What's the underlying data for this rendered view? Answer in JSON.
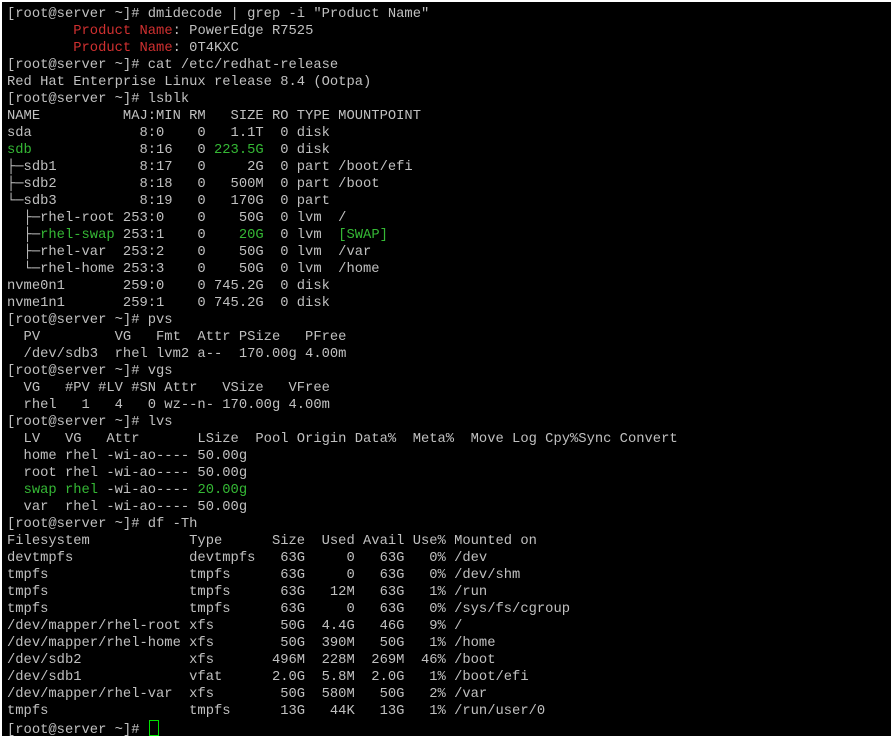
{
  "colors": {
    "background": "#000000",
    "text": "#c0c0c0",
    "highlight_red": "#d03030",
    "highlight_green": "#35b835",
    "cursor": "#00e000"
  },
  "terminal": {
    "lines": [
      [
        {
          "t": "[root@server ~]# dmidecode | grep -i \"Product Name\""
        }
      ],
      [
        {
          "t": "        "
        },
        {
          "t": "Product Name",
          "c": "red"
        },
        {
          "t": ": PowerEdge R7525"
        }
      ],
      [
        {
          "t": "        "
        },
        {
          "t": "Product Name",
          "c": "red"
        },
        {
          "t": ": 0T4KXC"
        }
      ],
      [
        {
          "t": "[root@server ~]# cat /etc/redhat-release"
        }
      ],
      [
        {
          "t": "Red Hat Enterprise Linux release 8.4 (Ootpa)"
        }
      ],
      [
        {
          "t": "[root@server ~]# lsblk"
        }
      ],
      [
        {
          "t": "NAME          MAJ:MIN RM   SIZE RO TYPE MOUNTPOINT"
        }
      ],
      [
        {
          "t": "sda             8:0    0   1.1T  0 disk"
        }
      ],
      [
        {
          "t": "sdb",
          "c": "green"
        },
        {
          "t": "             8:16   0 "
        },
        {
          "t": "223.5G",
          "c": "green"
        },
        {
          "t": "  0 disk"
        }
      ],
      [
        {
          "t": "├─sdb1          8:17   0     2G  0 part /boot/efi"
        }
      ],
      [
        {
          "t": "├─sdb2          8:18   0   500M  0 part /boot"
        }
      ],
      [
        {
          "t": "└─sdb3          8:19   0   170G  0 part"
        }
      ],
      [
        {
          "t": "  ├─rhel-root 253:0    0    50G  0 lvm  /"
        }
      ],
      [
        {
          "t": "  ├─"
        },
        {
          "t": "rhel-swap",
          "c": "green"
        },
        {
          "t": " 253:1    0    "
        },
        {
          "t": "20G",
          "c": "green"
        },
        {
          "t": "  0 lvm  "
        },
        {
          "t": "[SWAP]",
          "c": "green"
        }
      ],
      [
        {
          "t": "  ├─rhel-var  253:2    0    50G  0 lvm  /var"
        }
      ],
      [
        {
          "t": "  └─rhel-home 253:3    0    50G  0 lvm  /home"
        }
      ],
      [
        {
          "t": "nvme0n1       259:0    0 745.2G  0 disk"
        }
      ],
      [
        {
          "t": "nvme1n1       259:1    0 745.2G  0 disk"
        }
      ],
      [
        {
          "t": "[root@server ~]# pvs"
        }
      ],
      [
        {
          "t": "  PV         VG   Fmt  Attr PSize   PFree"
        }
      ],
      [
        {
          "t": "  /dev/sdb3  rhel lvm2 a--  170.00g 4.00m"
        }
      ],
      [
        {
          "t": "[root@server ~]# vgs"
        }
      ],
      [
        {
          "t": "  VG   #PV #LV #SN Attr   VSize   VFree"
        }
      ],
      [
        {
          "t": "  rhel   1   4   0 wz--n- 170.00g 4.00m"
        }
      ],
      [
        {
          "t": "[root@server ~]# lvs"
        }
      ],
      [
        {
          "t": "  LV   VG   Attr       LSize  Pool Origin Data%  Meta%  Move Log Cpy%Sync Convert"
        }
      ],
      [
        {
          "t": "  home rhel -wi-ao---- 50.00g"
        }
      ],
      [
        {
          "t": "  root rhel -wi-ao---- 50.00g"
        }
      ],
      [
        {
          "t": "  "
        },
        {
          "t": "swap rhel",
          "c": "green"
        },
        {
          "t": " -wi-ao---- "
        },
        {
          "t": "20.00g",
          "c": "green"
        }
      ],
      [
        {
          "t": "  var  rhel -wi-ao---- 50.00g"
        }
      ],
      [
        {
          "t": "[root@server ~]# df -Th"
        }
      ],
      [
        {
          "t": "Filesystem            Type      Size  Used Avail Use% Mounted on"
        }
      ],
      [
        {
          "t": "devtmpfs              devtmpfs   63G     0   63G   0% /dev"
        }
      ],
      [
        {
          "t": "tmpfs                 tmpfs      63G     0   63G   0% /dev/shm"
        }
      ],
      [
        {
          "t": "tmpfs                 tmpfs      63G   12M   63G   1% /run"
        }
      ],
      [
        {
          "t": "tmpfs                 tmpfs      63G     0   63G   0% /sys/fs/cgroup"
        }
      ],
      [
        {
          "t": "/dev/mapper/rhel-root xfs        50G  4.4G   46G   9% /"
        }
      ],
      [
        {
          "t": "/dev/mapper/rhel-home xfs        50G  390M   50G   1% /home"
        }
      ],
      [
        {
          "t": "/dev/sdb2             xfs       496M  228M  269M  46% /boot"
        }
      ],
      [
        {
          "t": "/dev/sdb1             vfat      2.0G  5.8M  2.0G   1% /boot/efi"
        }
      ],
      [
        {
          "t": "/dev/mapper/rhel-var  xfs        50G  580M   50G   2% /var"
        }
      ],
      [
        {
          "t": "tmpfs                 tmpfs      13G   44K   13G   1% /run/user/0"
        }
      ]
    ],
    "prompt": "[root@server ~]# "
  }
}
